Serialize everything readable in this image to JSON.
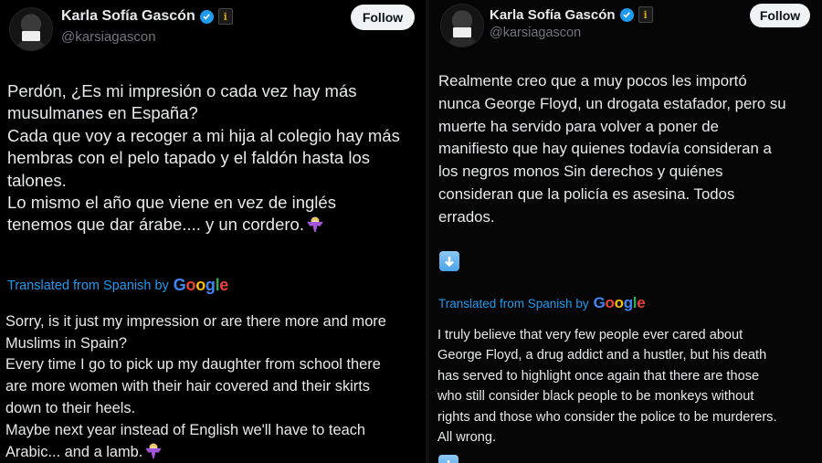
{
  "left": {
    "author": {
      "name": "Karla Sofía Gascón",
      "handle": "@karsiagascon"
    },
    "follow_label": "Follow",
    "original_lines": [
      "Perdón, ¿Es mi impresión o cada vez hay más",
      "musulmanes en España?",
      "Cada que voy a recoger a mi hija al colegio hay más",
      "hembras con el pelo tapado y el faldón hasta los",
      "talones.",
      "Lo mismo el año que viene en vez de inglés",
      "tenemos que dar árabe.... y un cordero."
    ],
    "translated_prefix": "Translated from Spanish by",
    "translated_lines": [
      "Sorry, is it just my impression or are there more and more",
      "Muslims in Spain?",
      "Every time I go to pick up my daughter from school there",
      "are more women with their hair covered and their skirts",
      "down to their heels.",
      "Maybe next year instead of English we'll have to teach",
      "Arabic... and a lamb."
    ]
  },
  "right": {
    "author": {
      "name": "Karla Sofía Gascón",
      "handle": "@karsiagascon"
    },
    "follow_label": "Follow",
    "original_lines": [
      "Realmente creo que a muy pocos les importó",
      "nunca George Floyd, un drogata estafador, pero su",
      "muerte ha servido para volver a poner de",
      "manifiesto que hay quienes todavía consideran a",
      "los negros monos Sin derechos y quiénes",
      "consideran que la policía es asesina. Todos",
      "errados."
    ],
    "translated_prefix": "Translated from Spanish by",
    "translated_lines": [
      "I truly believe that very few people ever cared about",
      "George Floyd, a drug addict and a hustler, but his death",
      "has served to highlight once again that there are those",
      "who still consider black people to be monkeys without",
      "rights and those who consider the police to be murderers.",
      "All wrong."
    ]
  },
  "google_letters": [
    "G",
    "o",
    "o",
    "g",
    "l",
    "e"
  ],
  "colors": {
    "link_blue": "#1d9bf0",
    "verified_blue": "#1d9bf0",
    "muted": "#71767b"
  },
  "icons": [
    "verified-badge-icon",
    "info-badge-icon",
    "shrug-emoji-icon",
    "down-arrow-emoji-icon"
  ]
}
